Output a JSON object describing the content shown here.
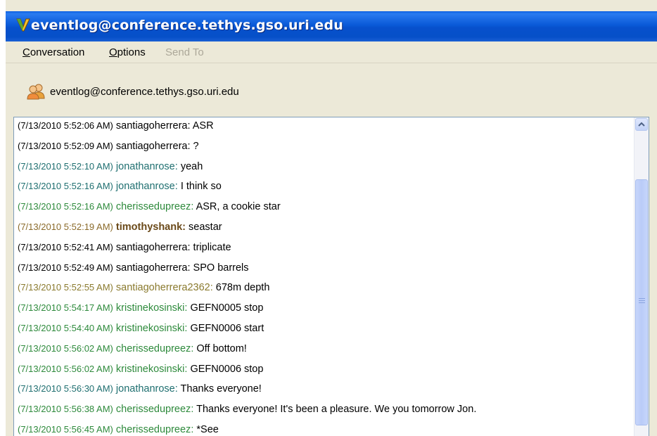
{
  "window": {
    "title": "eventlog@conference.tethys.gso.uri.edu"
  },
  "menu": {
    "items": [
      {
        "label": "Conversation",
        "accel": "C",
        "rest": "onversation",
        "enabled": true
      },
      {
        "label": "Options",
        "accel": "O",
        "rest": "ptions",
        "enabled": true
      },
      {
        "label": "Send To",
        "enabled": false
      }
    ]
  },
  "contact": {
    "name": "eventlog@conference.tethys.gso.uri.edu",
    "icon": "buddies-icon"
  },
  "log": [
    {
      "ts": "(7/13/2010 5:52:06 AM)",
      "nick": "santiagoherrera",
      "msg": "ASR",
      "color": "black"
    },
    {
      "ts": "(7/13/2010 5:52:09 AM)",
      "nick": "santiagoherrera",
      "msg": "?",
      "color": "black"
    },
    {
      "ts": "(7/13/2010 5:52:10 AM)",
      "nick": "jonathanrose",
      "msg": "yeah",
      "color": "teal"
    },
    {
      "ts": "(7/13/2010 5:52:16 AM)",
      "nick": "jonathanrose",
      "msg": "I think so",
      "color": "teal"
    },
    {
      "ts": "(7/13/2010 5:52:16 AM)",
      "nick": "cherissedupreez",
      "msg": "ASR, a cookie star",
      "color": "green"
    },
    {
      "ts": "(7/13/2010 5:52:19 AM)",
      "nick": "timothyshank",
      "msg": "seastar",
      "color": "brown"
    },
    {
      "ts": "(7/13/2010 5:52:41 AM)",
      "nick": "santiagoherrera",
      "msg": "triplicate",
      "color": "black"
    },
    {
      "ts": "(7/13/2010 5:52:49 AM)",
      "nick": "santiagoherrera",
      "msg": "SPO barrels",
      "color": "black"
    },
    {
      "ts": "(7/13/2010 5:52:55 AM)",
      "nick": "santiagoherrera2362",
      "msg": "678m depth",
      "color": "olive"
    },
    {
      "ts": "(7/13/2010 5:54:17 AM)",
      "nick": "kristinekosinski",
      "msg": "GEFN0005 stop",
      "color": "green"
    },
    {
      "ts": "(7/13/2010 5:54:40 AM)",
      "nick": "kristinekosinski",
      "msg": "GEFN0006 start",
      "color": "green"
    },
    {
      "ts": "(7/13/2010 5:56:02 AM)",
      "nick": "cherissedupreez",
      "msg": "Off bottom!",
      "color": "green"
    },
    {
      "ts": "(7/13/2010 5:56:02 AM)",
      "nick": "kristinekosinski",
      "msg": "GEFN0006 stop",
      "color": "green"
    },
    {
      "ts": "(7/13/2010 5:56:30 AM)",
      "nick": "jonathanrose",
      "msg": "Thanks everyone!",
      "color": "teal"
    },
    {
      "ts": "(7/13/2010 5:56:38 AM)",
      "nick": "cherissedupreez",
      "msg": "Thanks everyone! It's been a pleasure. We you tomorrow Jon.",
      "color": "green"
    },
    {
      "ts": "(7/13/2010 5:56:45 AM)",
      "nick": "cherissedupreez",
      "msg": "*See",
      "color": "green"
    }
  ],
  "colors": {
    "titlebar": "#0a5ad8",
    "window_bg": "#ece9d8",
    "nick_black": "#000000",
    "nick_teal": "#1f6f70",
    "nick_green": "#2e8a3c",
    "nick_brown": "#6b4a1a",
    "nick_olive": "#8a7a2e"
  }
}
